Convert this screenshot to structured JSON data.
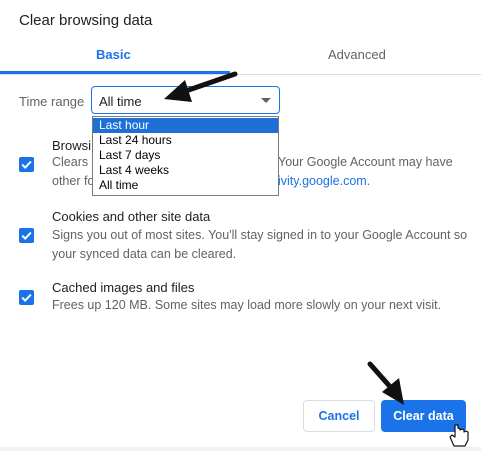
{
  "dialog": {
    "title": "Clear browsing data"
  },
  "tabs": [
    {
      "label": "Basic",
      "active": true
    },
    {
      "label": "Advanced",
      "active": false
    }
  ],
  "time_range": {
    "label": "Time range",
    "selected": "All time",
    "options": [
      "Last hour",
      "Last 24 hours",
      "Last 7 days",
      "Last 4 weeks",
      "All time"
    ],
    "highlighted": "Last hour"
  },
  "items": [
    {
      "title": "Browsing history",
      "title_visible": "Browsi",
      "desc_left_1": "Clears",
      "desc_right_1": "Your Google Account may have",
      "desc_left_2": "other fo",
      "desc_right_2": "ivity.google.com.",
      "checked": true
    },
    {
      "title": "Cookies and other site data",
      "desc_1": "Signs you out of most sites. You'll stay signed in to your Google Account so",
      "desc_2": "your synced data can be cleared.",
      "checked": true
    },
    {
      "title": "Cached images and files",
      "desc_1": "Frees up 120 MB. Some sites may load more slowly on your next visit.",
      "checked": true
    }
  ],
  "buttons": {
    "cancel": "Cancel",
    "clear": "Clear data"
  },
  "colors": {
    "accent": "#1a73e8",
    "highlight": "#1e70d7",
    "muted_text": "#5f6368"
  }
}
